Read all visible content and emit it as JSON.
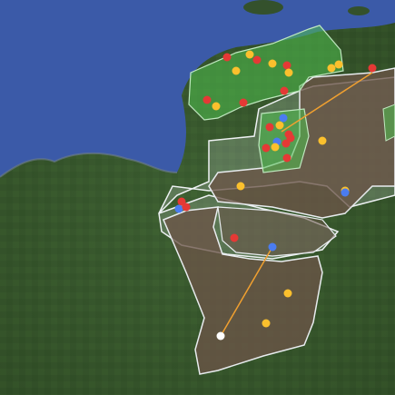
{
  "map": {
    "view": "satellite",
    "colors": {
      "sea": "#3b5aa8",
      "land_dark": "#2e4a2a",
      "land_mid": "#4a6b3c",
      "zone_brown": "#6b5448",
      "zone_green": "#4fc04f",
      "zone_outline": "#e8ecef",
      "route_line": "#f0a030",
      "marker_red": "#e53935",
      "marker_yellow": "#fbc02d",
      "marker_blue": "#4a7cf0",
      "marker_white": "#ffffff"
    },
    "marker_types": [
      "red",
      "yellow",
      "blue",
      "white"
    ],
    "icons": [
      "map-marker-red",
      "map-marker-yellow",
      "map-marker-blue",
      "map-marker-white"
    ]
  }
}
